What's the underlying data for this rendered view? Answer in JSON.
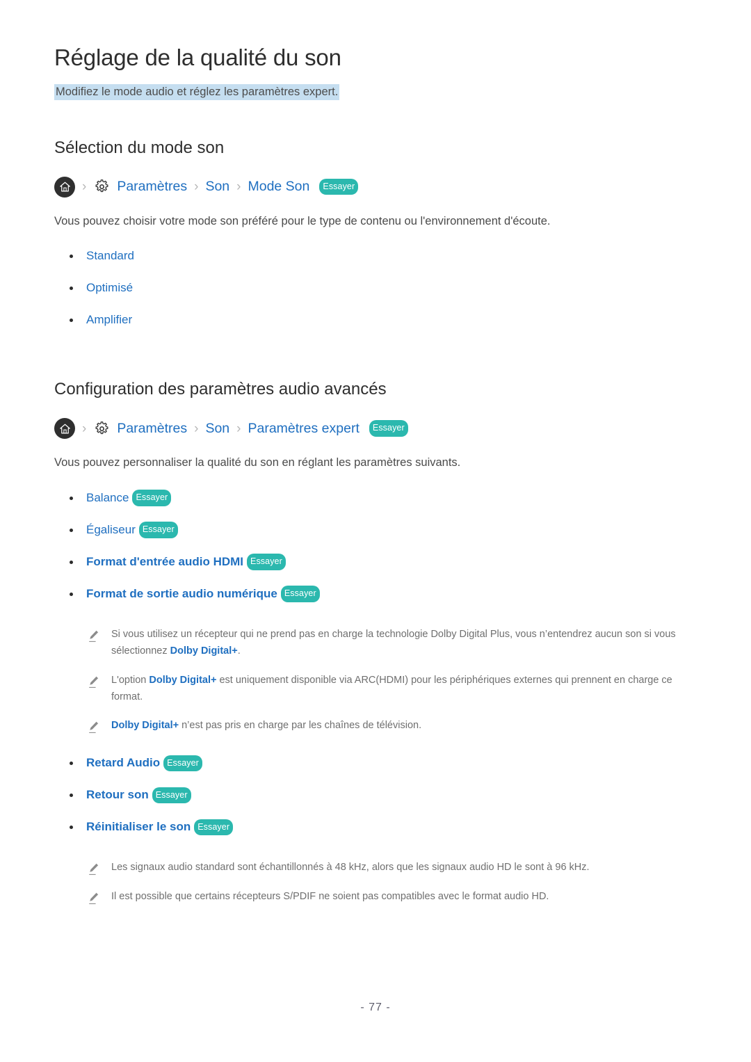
{
  "document": {
    "title": "Réglage de la qualité du son",
    "subtitle": "Modifiez le mode audio et réglez les paramètres expert.",
    "page_number": "- 77 -"
  },
  "icons": {
    "home": "home-icon",
    "gear": "gear-icon",
    "separator": "›",
    "pencil": "pencil-icon"
  },
  "colors": {
    "link_blue": "#1f6fc0",
    "badge_teal": "#2bb8ae",
    "highlight_blue": "#c5def0",
    "body_gray": "#4a4a4a",
    "note_gray": "#6f6f6f"
  },
  "badge_label": "Essayer",
  "sections": [
    {
      "heading": "Sélection du mode son",
      "breadcrumb": {
        "items": [
          "Paramètres",
          "Son",
          "Mode Son"
        ],
        "badge": "Essayer"
      },
      "intro": "Vous pouvez choisir votre mode son préféré pour le type de contenu ou l'environnement d'écoute.",
      "bullets": [
        {
          "label": "Standard",
          "badge": ""
        },
        {
          "label": "Optimisé",
          "badge": ""
        },
        {
          "label": "Amplifier",
          "badge": ""
        }
      ]
    },
    {
      "heading": "Configuration des paramètres audio avancés",
      "breadcrumb": {
        "items": [
          "Paramètres",
          "Son",
          "Paramètres expert"
        ],
        "badge": "Essayer"
      },
      "intro": "Vous pouvez personnaliser la qualité du son en réglant les paramètres suivants.",
      "bullets_group_1": [
        {
          "label": "Balance",
          "badge": "Essayer"
        },
        {
          "label": "Égaliseur",
          "badge": "Essayer"
        },
        {
          "label": "Format d'entrée audio HDMI",
          "badge": "Essayer"
        },
        {
          "label": "Format de sortie audio numérique",
          "badge": "Essayer"
        }
      ],
      "notes_group_1": [
        {
          "parts": [
            {
              "text": "Si vous utilisez un récepteur qui ne prend pas en charge la technologie Dolby Digital Plus, vous n’entendrez aucun son si vous sélectionnez ",
              "keyword": false
            },
            {
              "text": "Dolby Digital+",
              "keyword": true
            },
            {
              "text": ".",
              "keyword": false
            }
          ]
        },
        {
          "parts": [
            {
              "text": "L'option ",
              "keyword": false
            },
            {
              "text": "Dolby Digital+",
              "keyword": true
            },
            {
              "text": " est uniquement disponible via ARC(HDMI) pour les périphériques externes qui prennent en charge ce format.",
              "keyword": false
            }
          ]
        },
        {
          "parts": [
            {
              "text": "Dolby Digital+",
              "keyword": true
            },
            {
              "text": " n’est pas pris en charge par les chaînes de télévision.",
              "keyword": false
            }
          ]
        }
      ],
      "bullets_group_2": [
        {
          "label": "Retard Audio",
          "badge": "Essayer"
        },
        {
          "label": "Retour son",
          "badge": "Essayer"
        },
        {
          "label": "Réinitialiser le son",
          "badge": "Essayer"
        }
      ],
      "notes_group_2": [
        {
          "parts": [
            {
              "text": "Les signaux audio standard sont échantillonnés à 48 kHz, alors que les signaux audio HD le sont à 96 kHz.",
              "keyword": false
            }
          ]
        },
        {
          "parts": [
            {
              "text": "Il est possible que certains récepteurs S/PDIF ne soient pas compatibles avec le format audio HD.",
              "keyword": false
            }
          ]
        }
      ]
    }
  ]
}
